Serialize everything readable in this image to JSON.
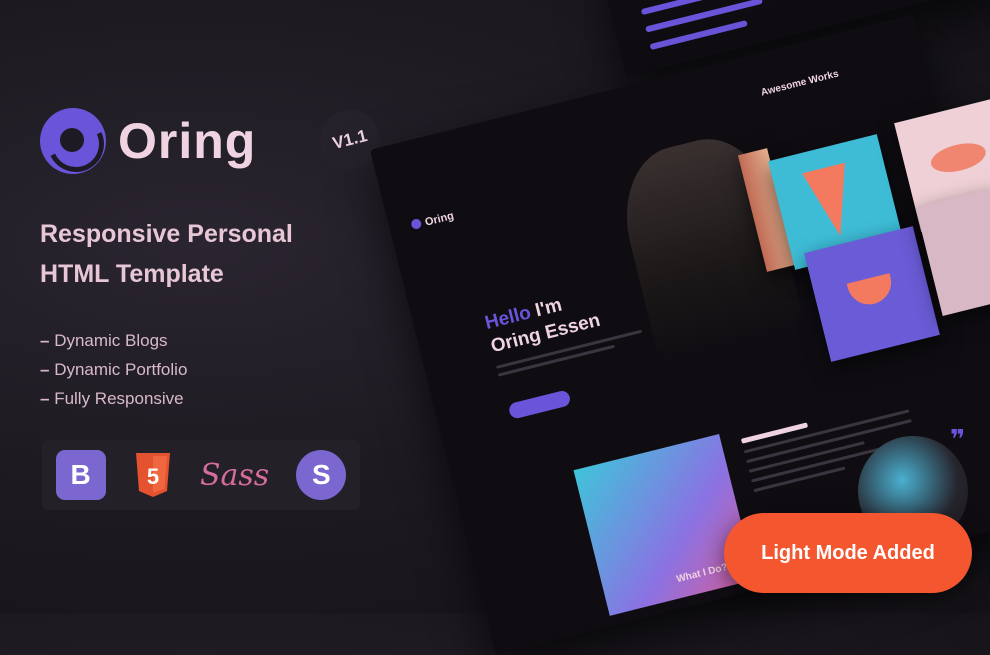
{
  "brand": {
    "name": "Oring",
    "version": "V1.1"
  },
  "headline": {
    "line1": "Responsive Personal",
    "line2": "HTML Template"
  },
  "features": [
    "Dynamic Blogs",
    "Dynamic Portfolio",
    "Fully Responsive"
  ],
  "tech_icons": {
    "bootstrap": "B",
    "html5": "5",
    "sass": "Sass",
    "stimulus": "S"
  },
  "mockup": {
    "nav_logo": "Oring",
    "hero_greeting": "Hello",
    "hero_im": "I'm",
    "hero_name": "Oring Essen",
    "works_title": "Awesome Works",
    "what_title": "What I Do?"
  },
  "badge": {
    "label": "Light Mode Added"
  },
  "colors": {
    "accent": "#6a54d9",
    "badge": "#f4562f",
    "background": "#1d1a21"
  }
}
